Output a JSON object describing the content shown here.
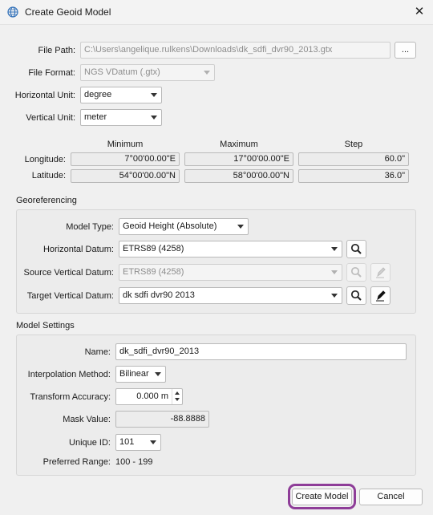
{
  "window": {
    "title": "Create Geoid Model",
    "icon": "globe-icon",
    "close_glyph": "✕"
  },
  "file_path": {
    "label": "File Path:",
    "value": "C:\\Users\\angelique.rulkens\\Downloads\\dk_sdfi_dvr90_2013.gtx",
    "browse_label": "..."
  },
  "file_format": {
    "label": "File Format:",
    "value": "NGS VDatum (.gtx)"
  },
  "horizontal_unit": {
    "label": "Horizontal Unit:",
    "value": "degree"
  },
  "vertical_unit": {
    "label": "Vertical Unit:",
    "value": "meter"
  },
  "extent": {
    "headers": {
      "minimum": "Minimum",
      "maximum": "Maximum",
      "step": "Step"
    },
    "longitude": {
      "label": "Longitude:",
      "minimum": "7°00'00.00\"E",
      "maximum": "17°00'00.00\"E",
      "step": "60.0\""
    },
    "latitude": {
      "label": "Latitude:",
      "minimum": "54°00'00.00\"N",
      "maximum": "58°00'00.00\"N",
      "step": "36.0\""
    }
  },
  "georeferencing": {
    "title": "Georeferencing",
    "model_type": {
      "label": "Model Type:",
      "value": "Geoid Height (Absolute)"
    },
    "horizontal_datum": {
      "label": "Horizontal Datum:",
      "value": "ETRS89 (4258)"
    },
    "source_vertical_datum": {
      "label": "Source Vertical Datum:",
      "value": "ETRS89 (4258)"
    },
    "target_vertical_datum": {
      "label": "Target Vertical Datum:",
      "value": "dk sdfi dvr90 2013"
    }
  },
  "model_settings": {
    "title": "Model Settings",
    "name": {
      "label": "Name:",
      "value": "dk_sdfi_dvr90_2013"
    },
    "interpolation_method": {
      "label": "Interpolation Method:",
      "value": "Bilinear"
    },
    "transform_accuracy": {
      "label": "Transform Accuracy:",
      "value": "0.000 m"
    },
    "mask_value": {
      "label": "Mask Value:",
      "value": "-88.8888"
    },
    "unique_id": {
      "label": "Unique ID:",
      "value": "101"
    },
    "preferred_range": {
      "label": "Preferred Range:",
      "value": "100 - 199"
    }
  },
  "footer": {
    "create_label": "Create Model",
    "cancel_label": "Cancel"
  },
  "colors": {
    "highlight": "#8e3d98",
    "background": "#f0f0f0"
  }
}
